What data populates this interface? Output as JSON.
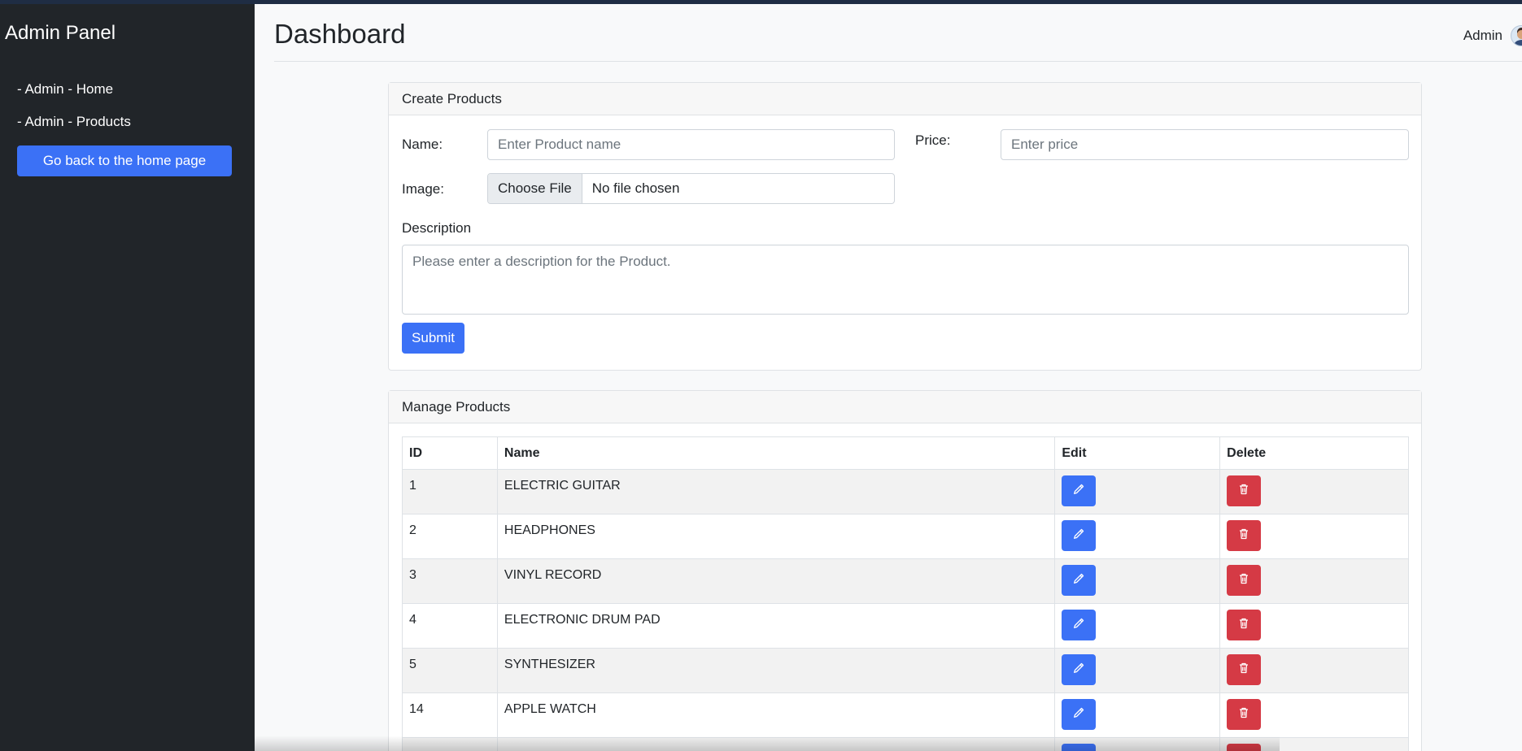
{
  "sidebar": {
    "title": "Admin Panel",
    "nav": [
      {
        "label": "- Admin - Home"
      },
      {
        "label": "- Admin - Products"
      }
    ],
    "home_button": "Go back to the home page"
  },
  "header": {
    "title": "Dashboard",
    "user_label": "Admin"
  },
  "create_card": {
    "title": "Create Products",
    "name_label": "Name:",
    "name_placeholder": "Enter Product name",
    "price_label": "Price:",
    "price_placeholder": "Enter price",
    "image_label": "Image:",
    "file_button": "Choose File",
    "file_status": "No file chosen",
    "description_label": "Description",
    "description_placeholder": "Please enter a description for the Product.",
    "submit_label": "Submit"
  },
  "manage_card": {
    "title": "Manage Products",
    "columns": [
      "ID",
      "Name",
      "Edit",
      "Delete"
    ],
    "rows": [
      {
        "id": "1",
        "name": "ELECTRIC GUITAR"
      },
      {
        "id": "2",
        "name": "HEADPHONES"
      },
      {
        "id": "3",
        "name": "VINYL RECORD"
      },
      {
        "id": "4",
        "name": "ELECTRONIC DRUM PAD"
      },
      {
        "id": "5",
        "name": "SYNTHESIZER"
      },
      {
        "id": "14",
        "name": "APPLE WATCH"
      },
      {
        "id": "",
        "name": ""
      }
    ]
  },
  "colors": {
    "sidebar_bg": "#212529",
    "primary": "#3b71f6",
    "danger": "#d53a45"
  },
  "icons": {
    "edit": "pencil-icon",
    "delete": "trash-icon"
  }
}
